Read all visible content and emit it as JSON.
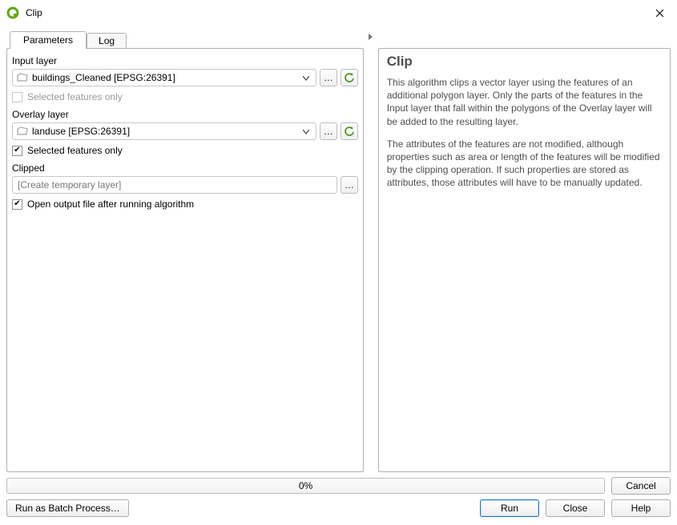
{
  "window": {
    "title": "Clip"
  },
  "tabs": {
    "parameters": "Parameters",
    "log": "Log"
  },
  "params": {
    "input_label": "Input layer",
    "input_value": "buildings_Cleaned [EPSG:26391]",
    "input_selected_only": "Selected features only",
    "overlay_label": "Overlay layer",
    "overlay_value": "landuse [EPSG:26391]",
    "overlay_selected_only": "Selected features only",
    "clipped_label": "Clipped",
    "clipped_placeholder": "[Create temporary layer]",
    "open_output": "Open output file after running algorithm",
    "browse_label": "…"
  },
  "help": {
    "title": "Clip",
    "p1": "This algorithm clips a vector layer using the features of an additional polygon layer. Only the parts of the features in the Input layer that fall within the polygons of the Overlay layer will be added to the resulting layer.",
    "p2": "The attributes of the features are not modified, although properties such as area or length of the features will be modified by the clipping operation. If such properties are stored as attributes, those attributes will have to be manually updated."
  },
  "footer": {
    "progress": "0%",
    "cancel": "Cancel",
    "batch": "Run as Batch Process…",
    "run": "Run",
    "close": "Close",
    "help": "Help"
  },
  "state": {
    "input_selected_only_checked": false,
    "input_selected_only_enabled": false,
    "overlay_selected_only_checked": true,
    "open_output_checked": true
  }
}
